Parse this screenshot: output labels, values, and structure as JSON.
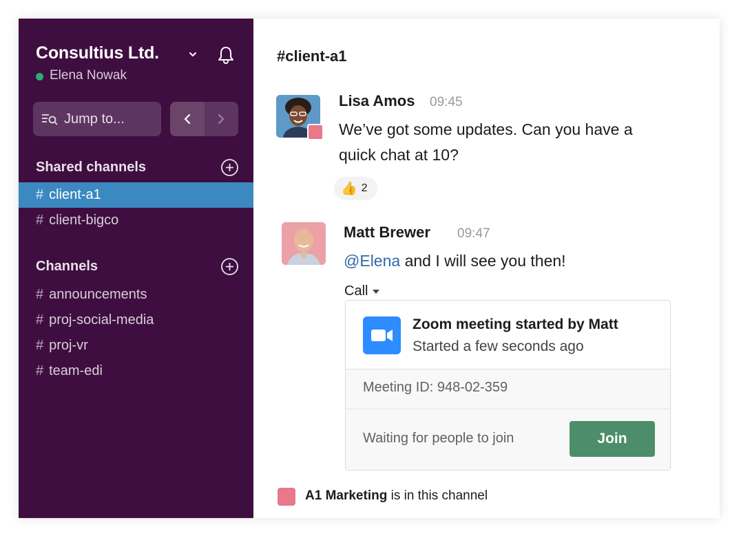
{
  "workspace": {
    "name": "Consultius Ltd.",
    "user": "Elena Nowak",
    "presence_color": "#2bac76"
  },
  "sidebar": {
    "jump_label": "Jump to...",
    "shared_title": "Shared channels",
    "shared_channels": [
      {
        "hash": "#",
        "name": "client-a1",
        "active": true
      },
      {
        "hash": "#",
        "name": "client-bigco",
        "active": false
      }
    ],
    "channels_title": "Channels",
    "channels": [
      {
        "hash": "#",
        "name": "announcements"
      },
      {
        "hash": "#",
        "name": "proj-social-media"
      },
      {
        "hash": "#",
        "name": "proj-vr"
      },
      {
        "hash": "#",
        "name": "team-edi"
      }
    ],
    "colors": {
      "background": "#3f0e40",
      "active": "#3c88c0"
    }
  },
  "channel": {
    "title": "#client-a1"
  },
  "messages": [
    {
      "author": "Lisa Amos",
      "time": "09:45",
      "text_line1": "We’ve got some updates. Can you have a",
      "text_line2": "quick chat at 10?",
      "reaction": {
        "emoji": "👍",
        "count": "2"
      }
    },
    {
      "author": "Matt Brewer",
      "time": "09:47",
      "mention": "@Elena",
      "text": " and I will see you then!"
    }
  ],
  "call": {
    "label": "Call",
    "title": "Zoom meeting started by Matt",
    "subtitle": "Started a few seconds ago",
    "meeting_id": "Meeting ID: 948-02-359",
    "waiting": "Waiting for people to join",
    "join_label": "Join",
    "join_color": "#4c8e69",
    "zoom_color": "#2d8cff"
  },
  "footer": {
    "org": "A1 Marketing",
    "suffix": " is in this channel",
    "badge_color": "#e8788a"
  },
  "icons": [
    "chevron-down-icon",
    "bell-icon",
    "search-list-icon",
    "arrow-left-icon",
    "arrow-right-icon",
    "add-circle-icon",
    "zoom-camera-icon",
    "caret-down-icon"
  ]
}
